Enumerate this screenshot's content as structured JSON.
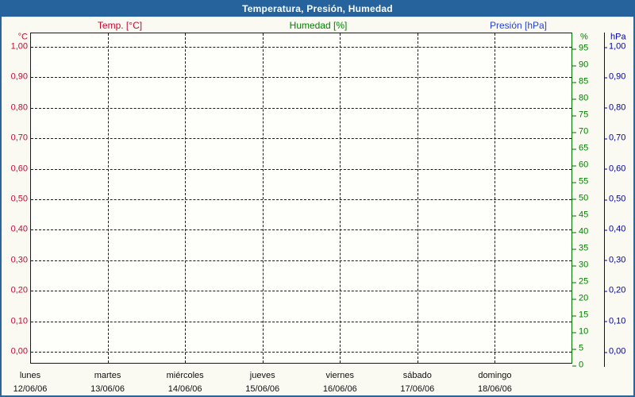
{
  "title": "Temperatura, Presión, Humedad",
  "legend": {
    "temp": "Temp. [°C]",
    "humidity": "Humedad [%]",
    "pressure": "Presión [hPa]"
  },
  "axes": {
    "left": {
      "unit": "°C",
      "ticks": [
        "1,00",
        "0,90",
        "0,80",
        "0,70",
        "0,60",
        "0,50",
        "0,40",
        "0,30",
        "0,20",
        "0,10",
        "0,00"
      ]
    },
    "humidity": {
      "unit": "%",
      "ticks": [
        "95",
        "90",
        "85",
        "80",
        "75",
        "70",
        "65",
        "60",
        "55",
        "50",
        "45",
        "40",
        "35",
        "30",
        "25",
        "20",
        "15",
        "10",
        "5",
        "0"
      ]
    },
    "pressure": {
      "unit": "hPa",
      "ticks": [
        "1,00",
        "0,90",
        "0,80",
        "0,70",
        "0,60",
        "0,50",
        "0,40",
        "0,30",
        "0,20",
        "0,10",
        "0,00"
      ]
    }
  },
  "x_axis": {
    "days": [
      {
        "name": "lunes",
        "date": "12/06/06"
      },
      {
        "name": "martes",
        "date": "13/06/06"
      },
      {
        "name": "miércoles",
        "date": "14/06/06"
      },
      {
        "name": "jueves",
        "date": "15/06/06"
      },
      {
        "name": "viernes",
        "date": "16/06/06"
      },
      {
        "name": "sábado",
        "date": "17/06/06"
      },
      {
        "name": "domingo",
        "date": "18/06/06"
      }
    ]
  },
  "colors": {
    "titlebar_bg": "#26639C",
    "titlebar_text": "#FFFFFF",
    "window_border": "#2C6598",
    "background": "#FAFAF2",
    "plot_bg": "#FEFEFA",
    "grid": "#1A1A1A",
    "temperature": "#C40A33",
    "humidity": "#008000",
    "humidity_axis": "#006F00",
    "pressure": "#0000A8",
    "pressure_header": "#2742D6"
  },
  "chart_data": {
    "type": "line",
    "title": "Temperatura, Presión, Humedad",
    "categories": [
      "lunes 12/06/06",
      "martes 13/06/06",
      "miércoles 14/06/06",
      "jueves 15/06/06",
      "viernes 16/06/06",
      "sábado 17/06/06",
      "domingo 18/06/06"
    ],
    "series": [
      {
        "name": "Temp. [°C]",
        "color": "#C40A33",
        "axis": "left",
        "values": []
      },
      {
        "name": "Humedad [%]",
        "color": "#008000",
        "axis": "right-humidity",
        "values": []
      },
      {
        "name": "Presión [hPa]",
        "color": "#0000A8",
        "axis": "right-pressure",
        "values": []
      }
    ],
    "axes": {
      "left": {
        "label": "°C",
        "min": 0.0,
        "max": 1.0,
        "step": 0.1,
        "number_format": "decimal-comma"
      },
      "humidity": {
        "label": "%",
        "min": 0,
        "max": 100,
        "tick_max_shown": 95,
        "step": 5
      },
      "pressure": {
        "label": "hPa",
        "min": 0.0,
        "max": 1.0,
        "step": 0.1,
        "number_format": "decimal-comma"
      }
    },
    "grid": "dashed",
    "legend_position": "top",
    "plotted_points": "none"
  }
}
